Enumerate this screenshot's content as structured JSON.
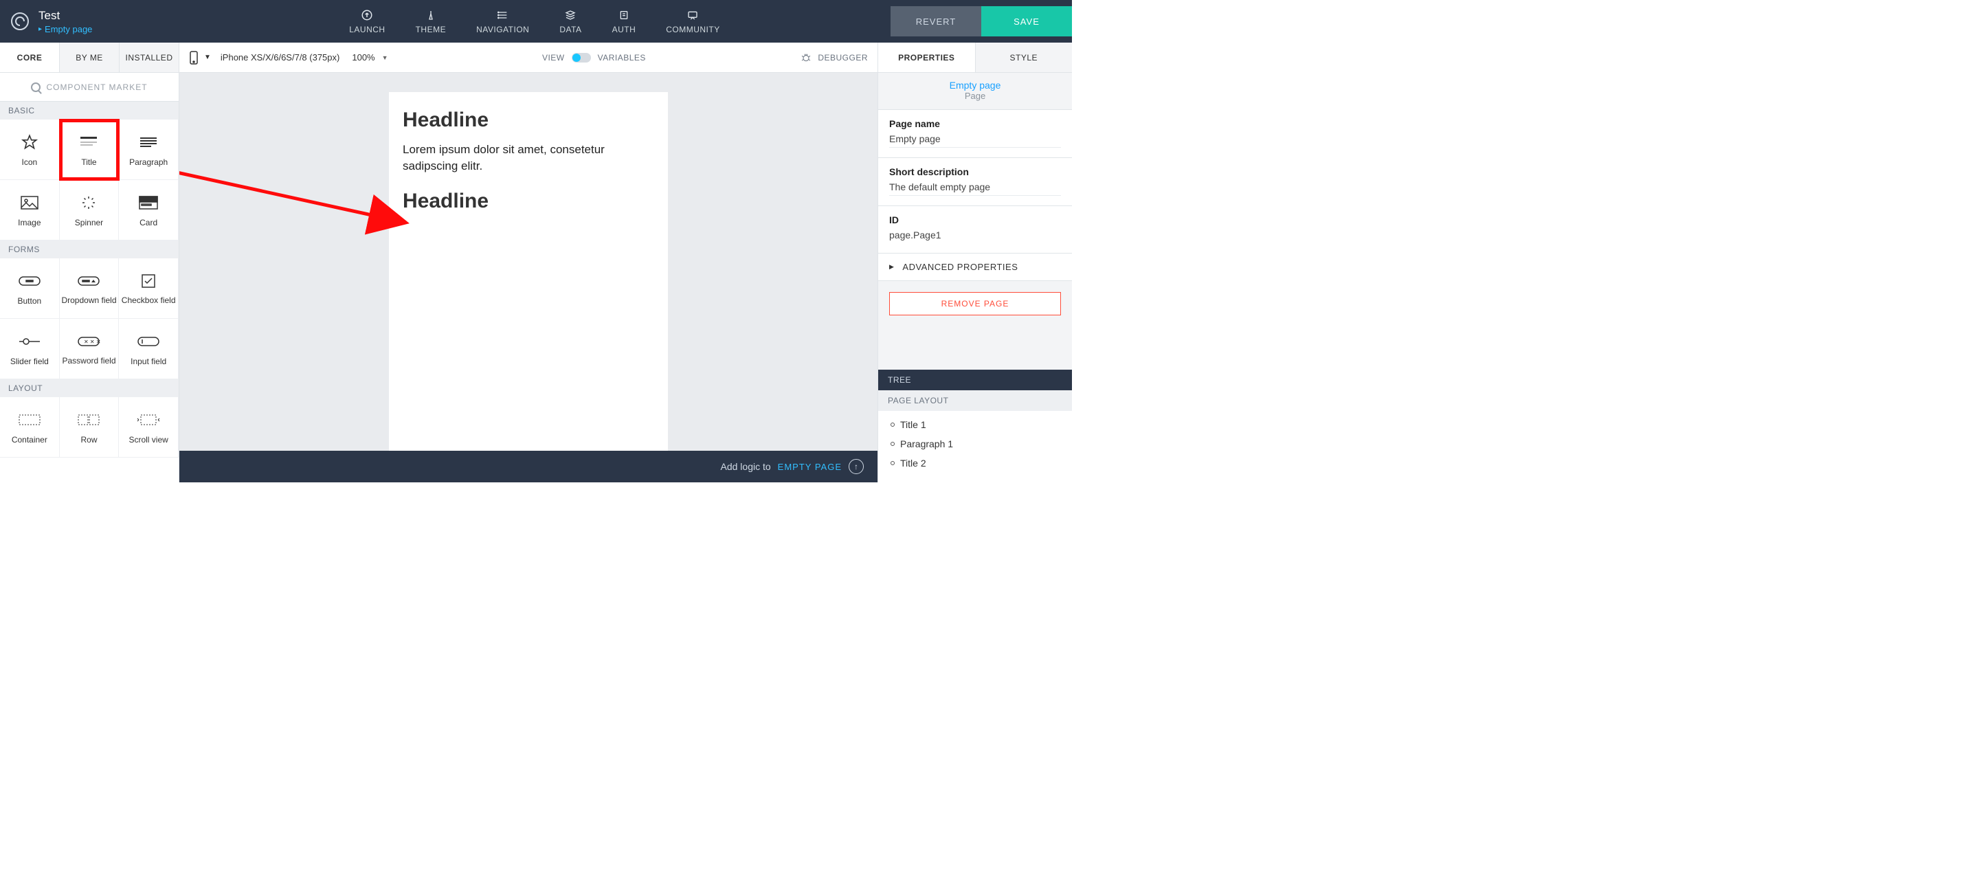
{
  "header": {
    "project_title": "Test",
    "project_page": "Empty page",
    "nav": [
      {
        "icon": "launch-icon",
        "label": "LAUNCH"
      },
      {
        "icon": "theme-icon",
        "label": "THEME"
      },
      {
        "icon": "navigation-icon",
        "label": "NAVIGATION"
      },
      {
        "icon": "data-icon",
        "label": "DATA"
      },
      {
        "icon": "auth-icon",
        "label": "AUTH"
      },
      {
        "icon": "community-icon",
        "label": "COMMUNITY"
      }
    ],
    "revert": "REVERT",
    "save": "SAVE"
  },
  "left": {
    "tabs": [
      "CORE",
      "BY ME",
      "INSTALLED"
    ],
    "market": "COMPONENT MARKET",
    "sections": [
      {
        "title": "BASIC",
        "items": [
          {
            "name": "icon",
            "label": "Icon"
          },
          {
            "name": "title",
            "label": "Title"
          },
          {
            "name": "paragraph",
            "label": "Paragraph"
          },
          {
            "name": "image",
            "label": "Image"
          },
          {
            "name": "spinner",
            "label": "Spinner"
          },
          {
            "name": "card",
            "label": "Card"
          }
        ]
      },
      {
        "title": "FORMS",
        "items": [
          {
            "name": "button",
            "label": "Button"
          },
          {
            "name": "dropdown-field",
            "label": "Dropdown field"
          },
          {
            "name": "checkbox-field",
            "label": "Checkbox field"
          },
          {
            "name": "slider-field",
            "label": "Slider field"
          },
          {
            "name": "password-field",
            "label": "Password field"
          },
          {
            "name": "input-field",
            "label": "Input field"
          }
        ]
      },
      {
        "title": "LAYOUT",
        "items": [
          {
            "name": "container",
            "label": "Container"
          },
          {
            "name": "row",
            "label": "Row"
          },
          {
            "name": "scroll-view",
            "label": "Scroll view"
          }
        ]
      }
    ]
  },
  "toolbar": {
    "device": "iPhone XS/X/6/6S/7/8 (375px)",
    "zoom": "100%",
    "view_label": "VIEW",
    "variables_label": "VARIABLES",
    "debugger": "DEBUGGER"
  },
  "canvas": {
    "headline1": "Headline",
    "paragraph": "Lorem ipsum dolor sit amet, consetetur sadipscing elitr.",
    "headline2": "Headline"
  },
  "bottombar": {
    "prefix": "Add logic to",
    "link": "EMPTY PAGE"
  },
  "right": {
    "tabs": [
      "PROPERTIES",
      "STYLE"
    ],
    "crumb_name": "Empty page",
    "crumb_type": "Page",
    "page_name_label": "Page name",
    "page_name_value": "Empty page",
    "short_desc_label": "Short description",
    "short_desc_value": "The default empty page",
    "id_label": "ID",
    "id_value": "page.Page1",
    "advanced": "ADVANCED PROPERTIES",
    "remove": "REMOVE PAGE",
    "tree_hdr": "TREE",
    "tree_sub": "PAGE LAYOUT",
    "tree_items": [
      "Title 1",
      "Paragraph 1",
      "Title 2"
    ]
  }
}
